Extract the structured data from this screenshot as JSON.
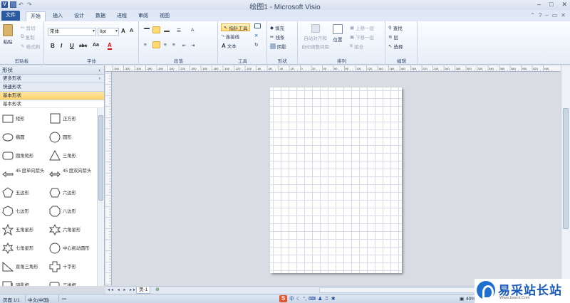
{
  "window": {
    "title": "绘图1 - Microsoft Visio",
    "app_logo": "V",
    "controls": [
      "–",
      "□",
      "✕"
    ]
  },
  "ribbon_tabs": [
    "文件",
    "开始",
    "插入",
    "设计",
    "数据",
    "进程",
    "审阅",
    "视图"
  ],
  "ribbon": {
    "clipboard": {
      "paste": "粘贴",
      "cut": "剪切",
      "copy": "复制",
      "format_painter": "格式刷",
      "group": "剪贴板"
    },
    "font": {
      "font_name": "宋体",
      "font_size": "8pt",
      "grow": "A",
      "shrink": "A",
      "bold": "B",
      "italic": "I",
      "underline": "U",
      "strike": "abc",
      "case": "Aa",
      "color": "A",
      "group": "字体"
    },
    "paragraph": {
      "group": "段落"
    },
    "tools": {
      "pointer": "指针工具",
      "connector": "连接线",
      "text": "文本",
      "group": "工具"
    },
    "shape_styles": {
      "fill": "填充",
      "line": "线条",
      "shadow": "阴影",
      "group": "形状"
    },
    "arrange": {
      "auto_align": "自动对齐和",
      "auto_align2": "自动调整间距",
      "position": "位置",
      "bring_forward": "上移一层",
      "send_backward": "下移一层",
      "group_btn": "组合",
      "group": "排列"
    },
    "editing": {
      "find": "查找",
      "layers": "层",
      "select": "选择",
      "group": "编辑"
    }
  },
  "shapes_panel": {
    "title": "形状",
    "more_shapes": "更多形状",
    "quick_shapes": "快速形状",
    "basic_shapes": "基本形状",
    "stencil_title": "基本形状",
    "items": [
      {
        "label": "矩形",
        "icon": "rectangle-icon"
      },
      {
        "label": "正方形",
        "icon": "square-icon"
      },
      {
        "label": "椭圆",
        "icon": "ellipse-icon"
      },
      {
        "label": "圆形",
        "icon": "circle-icon"
      },
      {
        "label": "圆角矩形",
        "icon": "rounded-rectangle-icon"
      },
      {
        "label": "三角形",
        "icon": "triangle-icon"
      },
      {
        "label": "45 度单向箭头",
        "icon": "single-arrow-icon"
      },
      {
        "label": "45 度双向箭头",
        "icon": "double-arrow-icon"
      },
      {
        "label": "五边形",
        "icon": "pentagon-icon"
      },
      {
        "label": "六边形",
        "icon": "hexagon-icon"
      },
      {
        "label": "七边形",
        "icon": "heptagon-icon"
      },
      {
        "label": "八边形",
        "icon": "octagon-icon"
      },
      {
        "label": "五角星形",
        "icon": "five-star-icon"
      },
      {
        "label": "六角星形",
        "icon": "six-star-icon"
      },
      {
        "label": "七角星形",
        "icon": "seven-star-icon"
      },
      {
        "label": "中心拖动圆形",
        "icon": "center-drag-circle-icon"
      },
      {
        "label": "直角三角形",
        "icon": "right-triangle-icon"
      },
      {
        "label": "十字形",
        "icon": "cross-icon"
      },
      {
        "label": "阴影框",
        "icon": "shadow-box-icon"
      },
      {
        "label": "三维框",
        "icon": "3d-box-icon"
      }
    ]
  },
  "page_tabs": {
    "nav": "◂◂ ◂ ▸ ▸▸",
    "page": "页-1"
  },
  "status": {
    "page": "页面 1/1",
    "language": "中文(中国)",
    "ime_label": "中",
    "zoom": "40%"
  },
  "watermark": {
    "big": "易采站长站",
    "small": "Www.Easck.Com"
  },
  "ruler_labels": [
    "-340",
    "-320",
    "-300",
    "-280",
    "-260",
    "-240",
    "-220",
    "-200",
    "-180",
    "-160",
    "-140",
    "-120",
    "-100",
    "-80",
    "-60",
    "-40",
    "-20",
    "0",
    "20",
    "40",
    "60",
    "80",
    "100",
    "120",
    "140",
    "160",
    "180",
    "200",
    "220",
    "240",
    "260",
    "280",
    "300",
    "320",
    "340",
    "360",
    "380",
    "400",
    "420",
    "440"
  ]
}
